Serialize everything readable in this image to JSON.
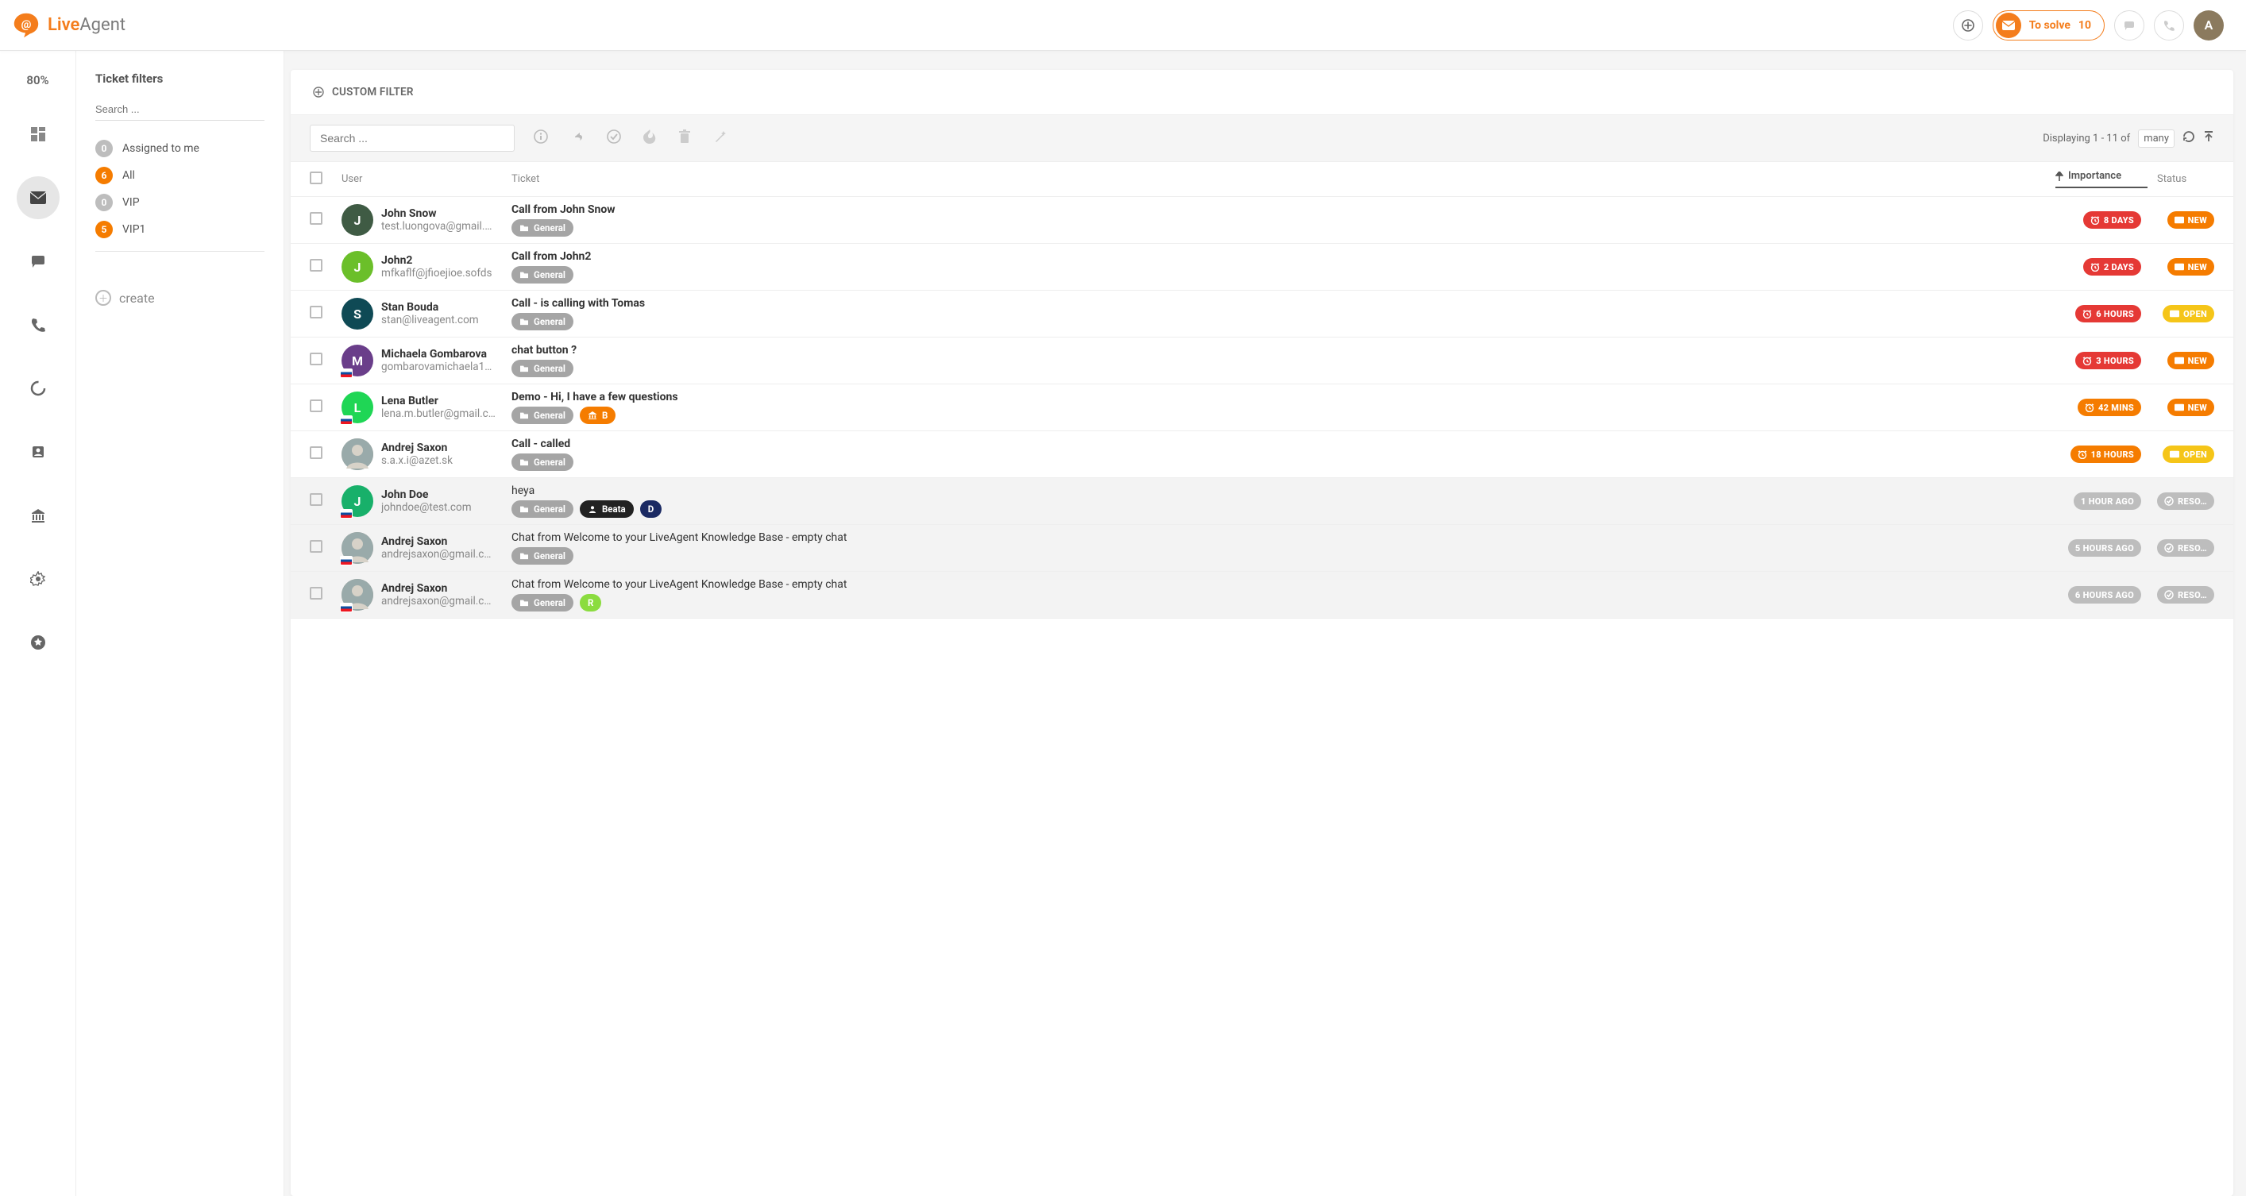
{
  "brand": {
    "live": "Live",
    "agent": "Agent"
  },
  "header": {
    "to_solve_label": "To solve",
    "to_solve_count": "10",
    "avatar_letter": "A"
  },
  "nav": {
    "progress": "80%"
  },
  "sidebar": {
    "title": "Ticket filters",
    "search_placeholder": "Search ...",
    "filters": [
      {
        "count": "0",
        "label": "Assigned to me",
        "color": "grey"
      },
      {
        "count": "6",
        "label": "All",
        "color": "orange"
      },
      {
        "count": "0",
        "label": "VIP",
        "color": "grey"
      },
      {
        "count": "5",
        "label": "VIP1",
        "color": "orange"
      }
    ],
    "create_label": "create"
  },
  "toolbar": {
    "custom_filter": "CUSTOM FILTER",
    "search_placeholder": "Search ...",
    "paging_text": "Displaying 1 - 11 of",
    "paging_select": "many"
  },
  "columns": {
    "user": "User",
    "ticket": "Ticket",
    "importance": "Importance",
    "status": "Status"
  },
  "rows": [
    {
      "avatar": {
        "type": "letter",
        "letter": "J",
        "bg": "#3f5b44",
        "flag": false
      },
      "name": "John Snow",
      "email": "test.luongova@gmail.…",
      "title": "Call from John Snow",
      "tags": [
        {
          "label": "General",
          "style": "grey",
          "icon": "folder"
        }
      ],
      "importance": {
        "text": "8 DAYS",
        "color": "red",
        "icon": "clock"
      },
      "status": {
        "text": "NEW",
        "color": "orange",
        "icon": "mail"
      },
      "dim": false
    },
    {
      "avatar": {
        "type": "letter",
        "letter": "J",
        "bg": "#6bbf2a",
        "flag": false
      },
      "name": "John2",
      "email": "mfkaflf@jfioejioe.sofds",
      "title": "Call from John2",
      "tags": [
        {
          "label": "General",
          "style": "grey",
          "icon": "folder"
        }
      ],
      "importance": {
        "text": "2 DAYS",
        "color": "red",
        "icon": "clock"
      },
      "status": {
        "text": "NEW",
        "color": "orange",
        "icon": "mail"
      },
      "dim": false
    },
    {
      "avatar": {
        "type": "letter",
        "letter": "S",
        "bg": "#0f4a55",
        "flag": false
      },
      "name": "Stan Bouda",
      "email": "stan@liveagent.com",
      "title": "Call - is calling with Tomas",
      "tags": [
        {
          "label": "General",
          "style": "grey",
          "icon": "folder"
        }
      ],
      "importance": {
        "text": "6 HOURS",
        "color": "red",
        "icon": "clock"
      },
      "status": {
        "text": "OPEN",
        "color": "yellow",
        "icon": "mail"
      },
      "dim": false
    },
    {
      "avatar": {
        "type": "letter",
        "letter": "M",
        "bg": "#6a3e8a",
        "flag": true
      },
      "name": "Michaela Gombarova",
      "email": "gombarovamichaela1…",
      "title": "chat button ?",
      "tags": [
        {
          "label": "General",
          "style": "grey",
          "icon": "folder"
        }
      ],
      "importance": {
        "text": "3 HOURS",
        "color": "red",
        "icon": "clock"
      },
      "status": {
        "text": "NEW",
        "color": "orange",
        "icon": "mail"
      },
      "dim": false
    },
    {
      "avatar": {
        "type": "letter",
        "letter": "L",
        "bg": "#1fd655",
        "flag": true
      },
      "name": "Lena Butler",
      "email": "lena.m.butler@gmail.c…",
      "title": "Demo - Hi, I have a few questions",
      "tags": [
        {
          "label": "General",
          "style": "grey",
          "icon": "folder"
        },
        {
          "label": "B",
          "style": "orange",
          "icon": "bank"
        }
      ],
      "importance": {
        "text": "42 MINS",
        "color": "orange",
        "icon": "clock"
      },
      "status": {
        "text": "NEW",
        "color": "orange",
        "icon": "mail"
      },
      "dim": false
    },
    {
      "avatar": {
        "type": "photo",
        "letter": "",
        "bg": "",
        "flag": false
      },
      "name": "Andrej Saxon",
      "email": "s.a.x.i@azet.sk",
      "title": "Call - called",
      "tags": [
        {
          "label": "General",
          "style": "grey",
          "icon": "folder"
        }
      ],
      "importance": {
        "text": "18 HOURS",
        "color": "orange",
        "icon": "clock"
      },
      "status": {
        "text": "OPEN",
        "color": "yellow",
        "icon": "mail"
      },
      "dim": false
    },
    {
      "avatar": {
        "type": "letter",
        "letter": "J",
        "bg": "#18b06a",
        "flag": true
      },
      "name": "John Doe",
      "email": "johndoe@test.com",
      "title": "heya",
      "tags": [
        {
          "label": "General",
          "style": "grey",
          "icon": "folder"
        },
        {
          "label": "Beata",
          "style": "black",
          "icon": "person"
        },
        {
          "label": "D",
          "style": "navy",
          "icon": ""
        }
      ],
      "importance": {
        "text": "1 HOUR AGO",
        "color": "grey",
        "icon": ""
      },
      "status": {
        "text": "RESO…",
        "color": "grey",
        "icon": "check"
      },
      "dim": true
    },
    {
      "avatar": {
        "type": "photo",
        "letter": "",
        "bg": "",
        "flag": true
      },
      "name": "Andrej Saxon",
      "email": "andrejsaxon@gmail.c…",
      "title": "Chat from Welcome to your LiveAgent Knowledge Base - empty chat",
      "tags": [
        {
          "label": "General",
          "style": "grey",
          "icon": "folder"
        }
      ],
      "importance": {
        "text": "5 HOURS AGO",
        "color": "grey",
        "icon": ""
      },
      "status": {
        "text": "RESO…",
        "color": "grey",
        "icon": "check"
      },
      "dim": true
    },
    {
      "avatar": {
        "type": "photo",
        "letter": "",
        "bg": "",
        "flag": true
      },
      "name": "Andrej Saxon",
      "email": "andrejsaxon@gmail.c…",
      "title": "Chat from Welcome to your LiveAgent Knowledge Base - empty chat",
      "tags": [
        {
          "label": "General",
          "style": "grey",
          "icon": "folder"
        },
        {
          "label": "R",
          "style": "lime",
          "icon": ""
        }
      ],
      "importance": {
        "text": "6 HOURS AGO",
        "color": "grey",
        "icon": ""
      },
      "status": {
        "text": "RESO…",
        "color": "grey",
        "icon": "check"
      },
      "dim": true
    }
  ]
}
